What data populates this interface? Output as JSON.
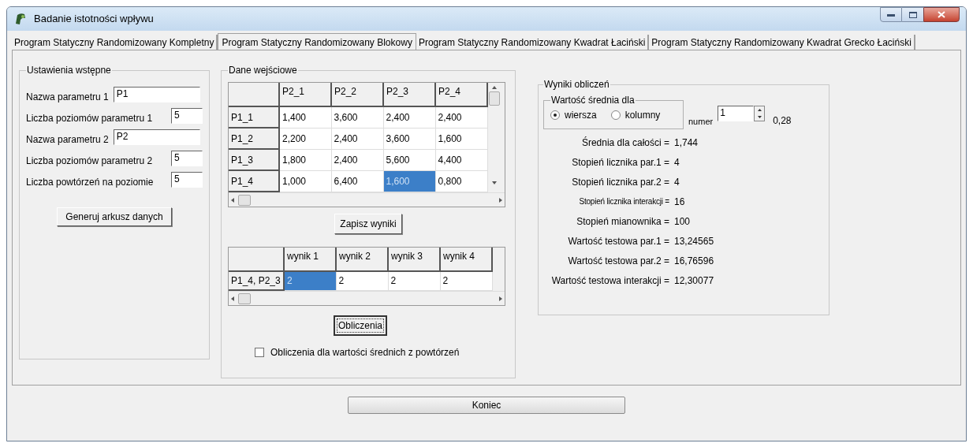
{
  "window": {
    "title": "Badanie istotności wpływu"
  },
  "tabs": [
    {
      "label": "Program Statyczny Randomizowany Kompletny",
      "selected": false
    },
    {
      "label": "Program Statyczny Randomizowany Blokowy",
      "selected": true
    },
    {
      "label": "Program Statyczny Randomizowany Kwadrat Łaciński",
      "selected": false
    },
    {
      "label": "Program Statyczny Randomizowany Kwadrat Grecko Łaciński",
      "selected": false
    }
  ],
  "setup": {
    "title": "Ustawienia wstępne",
    "fields": [
      {
        "label": "Nazwa parametru 1",
        "value": "P1",
        "kind": "wide"
      },
      {
        "label": "Liczba poziomów parametru 1",
        "value": "5",
        "kind": "narrow"
      },
      {
        "label": "Nazwa parametru 2",
        "value": "P2",
        "kind": "wide"
      },
      {
        "label": "Liczba poziomów parametru 2",
        "value": "5",
        "kind": "narrow"
      },
      {
        "label": "Liczba powtórzeń na poziomie",
        "value": "5",
        "kind": "narrow"
      }
    ],
    "button": "Generuj arkusz danych"
  },
  "input_data": {
    "title": "Dane wejściowe",
    "grid": {
      "columns": [
        "P2_1",
        "P2_2",
        "P2_3",
        "P2_4"
      ],
      "rows": [
        {
          "header": "P1_1",
          "cells": [
            {
              "text": "1,400",
              "selected": false
            },
            {
              "text": "3,600",
              "selected": false
            },
            {
              "text": "2,400",
              "selected": false
            },
            {
              "text": "2,400",
              "selected": false
            }
          ]
        },
        {
          "header": "P1_2",
          "cells": [
            {
              "text": "2,200",
              "selected": false
            },
            {
              "text": "2,400",
              "selected": false
            },
            {
              "text": "3,600",
              "selected": false
            },
            {
              "text": "1,600",
              "selected": false
            }
          ]
        },
        {
          "header": "P1_3",
          "cells": [
            {
              "text": "1,800",
              "selected": false
            },
            {
              "text": "2,400",
              "selected": false
            },
            {
              "text": "5,600",
              "selected": false
            },
            {
              "text": "4,400",
              "selected": false
            }
          ]
        },
        {
          "header": "P1_4",
          "cells": [
            {
              "text": "1,000",
              "selected": false
            },
            {
              "text": "6,400",
              "selected": false
            },
            {
              "text": "1,600",
              "selected": true
            },
            {
              "text": "0,800",
              "selected": false
            }
          ]
        }
      ]
    },
    "save_button": "Zapisz wyniki",
    "results_grid": {
      "columns": [
        "wynik 1",
        "wynik 2",
        "wynik 3",
        "wynik 4"
      ],
      "rows": [
        {
          "header": "P1_4, P2_3",
          "cells": [
            {
              "text": "2",
              "selected": true
            },
            {
              "text": "2",
              "selected": false
            },
            {
              "text": "2",
              "selected": false
            },
            {
              "text": "2",
              "selected": false
            }
          ]
        }
      ]
    },
    "calc_button": "Obliczenia",
    "checkbox": {
      "label": "Obliczenia dla wartości średnich z  powtórzeń",
      "checked": false
    }
  },
  "results": {
    "title": "Wyniki obliczeń",
    "mean_group": {
      "title": "Wartość średnia dla",
      "options": [
        {
          "label": "wiersza",
          "selected": true
        },
        {
          "label": "kolumny",
          "selected": false
        }
      ]
    },
    "number": {
      "label": "numer",
      "value": "1"
    },
    "number_result": "0,28",
    "lines": [
      {
        "label": "Średnia dla całości =",
        "value": "1,744",
        "kind": "normal"
      },
      {
        "label": "Stopień licznika par.1 =",
        "value": "4",
        "kind": "normal"
      },
      {
        "label": "Stopień licznika par.2 =",
        "value": "4",
        "kind": "normal"
      },
      {
        "label": "Stopień licznika interakcji =",
        "value": "16",
        "kind": "compact"
      },
      {
        "label": "Stopień mianownika =",
        "value": "100",
        "kind": "normal"
      },
      {
        "label": "Wartość testowa par.1 =",
        "value": "13,24565",
        "kind": "normal"
      },
      {
        "label": "Wartość testowa par.2 =",
        "value": "16,76596",
        "kind": "normal"
      },
      {
        "label": "Wartość testowa interakcji =",
        "value": "12,30077",
        "kind": "normal"
      }
    ]
  },
  "close_button": "Koniec"
}
